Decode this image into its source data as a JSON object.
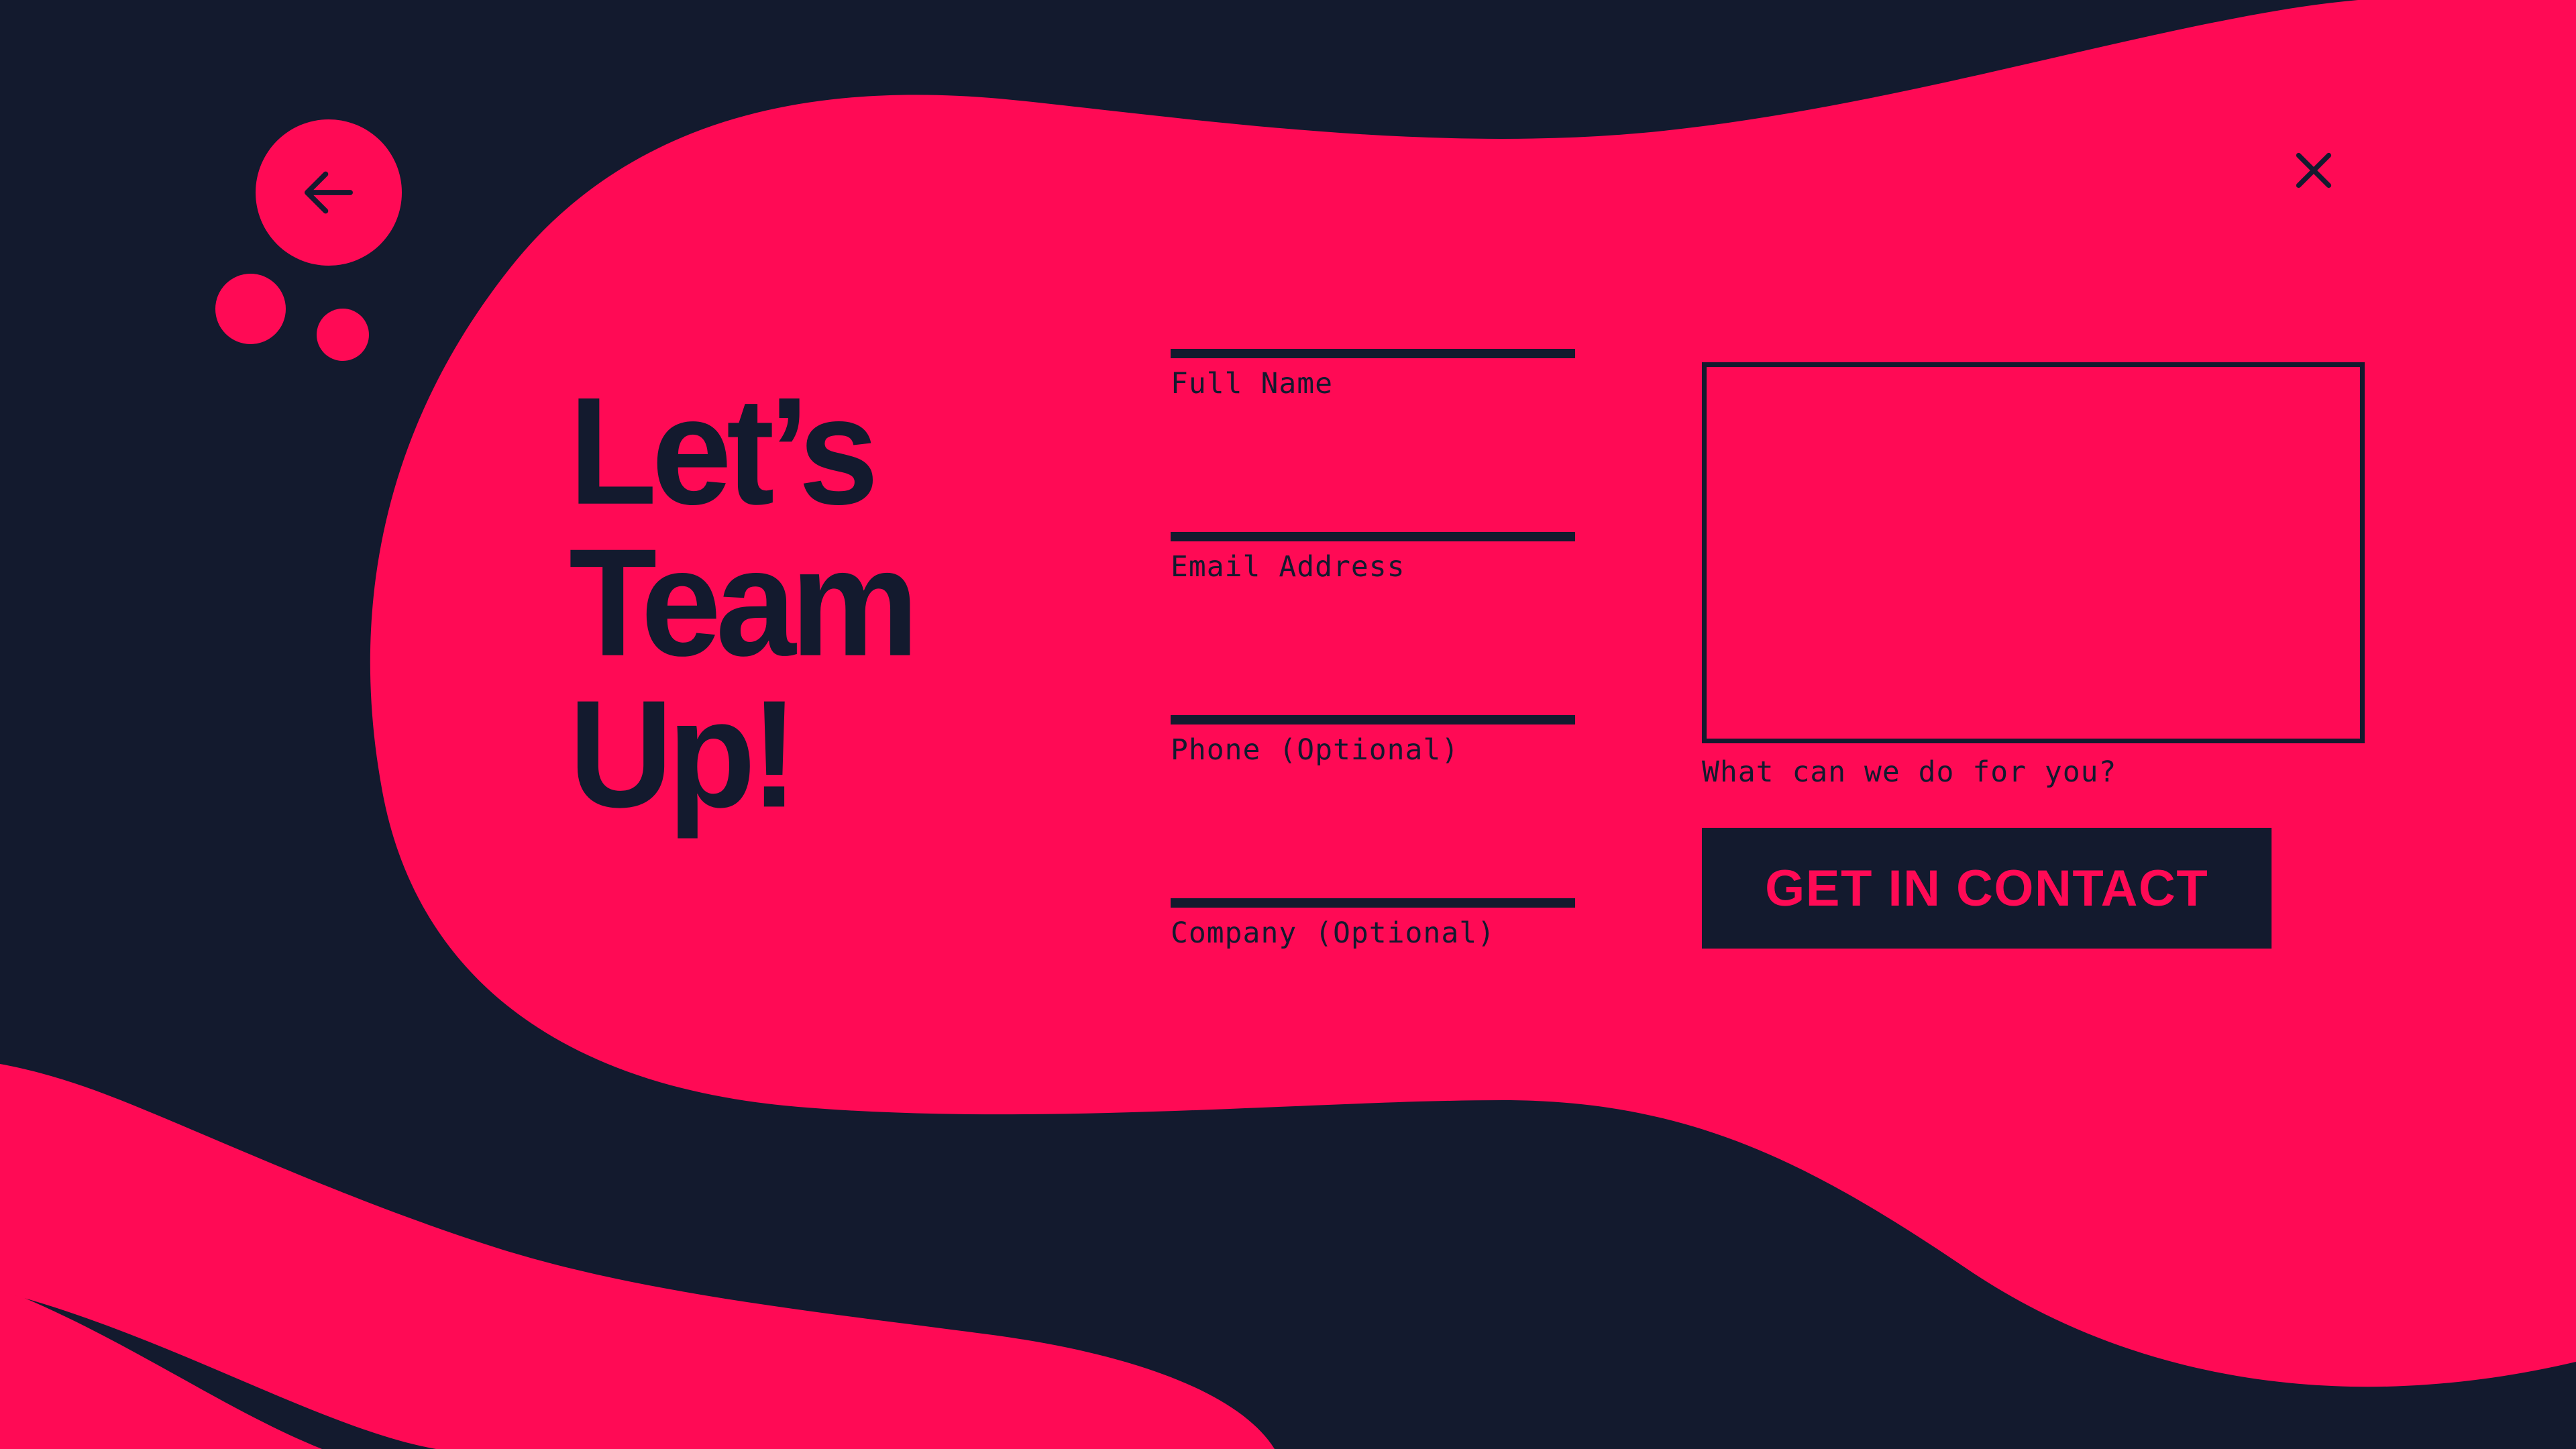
{
  "theme": {
    "accent_pink": "#FF0A55",
    "dark_navy": "#131a2e"
  },
  "nav": {
    "back_label": "Back",
    "back_icon": "arrow-left-icon",
    "close_label": "Close",
    "close_icon": "close-icon"
  },
  "headline": {
    "text": "Let’s\nTeam\nUp!"
  },
  "form": {
    "fields": [
      {
        "name": "full-name",
        "label": "Full Name",
        "value": "",
        "placeholder": "Full Name"
      },
      {
        "name": "email",
        "label": "Email Address",
        "value": "",
        "placeholder": "Email Address"
      },
      {
        "name": "phone",
        "label": "Phone (Optional)",
        "value": "",
        "placeholder": "Phone (Optional)"
      },
      {
        "name": "company",
        "label": "Company (Optional)",
        "value": "",
        "placeholder": "Company (Optional)"
      }
    ],
    "message": {
      "label": "What can we do for you?",
      "value": "",
      "placeholder": ""
    },
    "submit_label": "GET IN CONTACT"
  },
  "decor": {
    "dot_large": "decorative-circle-large",
    "dot_small": "decorative-circle-small"
  }
}
